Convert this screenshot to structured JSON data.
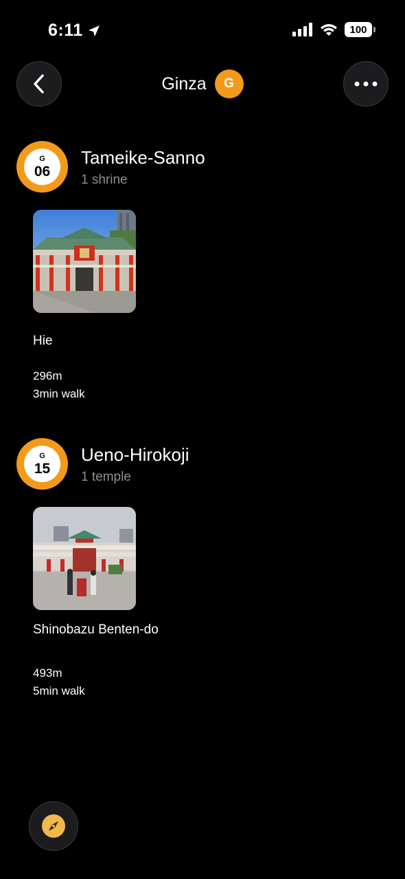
{
  "status_bar": {
    "time": "6:11",
    "battery": "100"
  },
  "header": {
    "title": "Ginza",
    "line_badge": "G"
  },
  "colors": {
    "accent": "#f39a1b",
    "background": "#000000",
    "secondary_text": "#8e8e93"
  },
  "stations": [
    {
      "line": "G",
      "number": "06",
      "name": "Tameike-Sanno",
      "count": "1 shrine",
      "places": [
        {
          "name": "Hie",
          "distance": "296m",
          "walk": "3min walk"
        }
      ]
    },
    {
      "line": "G",
      "number": "15",
      "name": "Ueno-Hirokoji",
      "count": "1 temple",
      "places": [
        {
          "name": "Shinobazu Benten-do",
          "distance": "493m",
          "walk": "5min walk"
        }
      ]
    }
  ],
  "icons": {
    "back": "chevron-left-icon",
    "more": "ellipsis-icon",
    "compass": "compass-icon",
    "location": "location-arrow-icon"
  }
}
